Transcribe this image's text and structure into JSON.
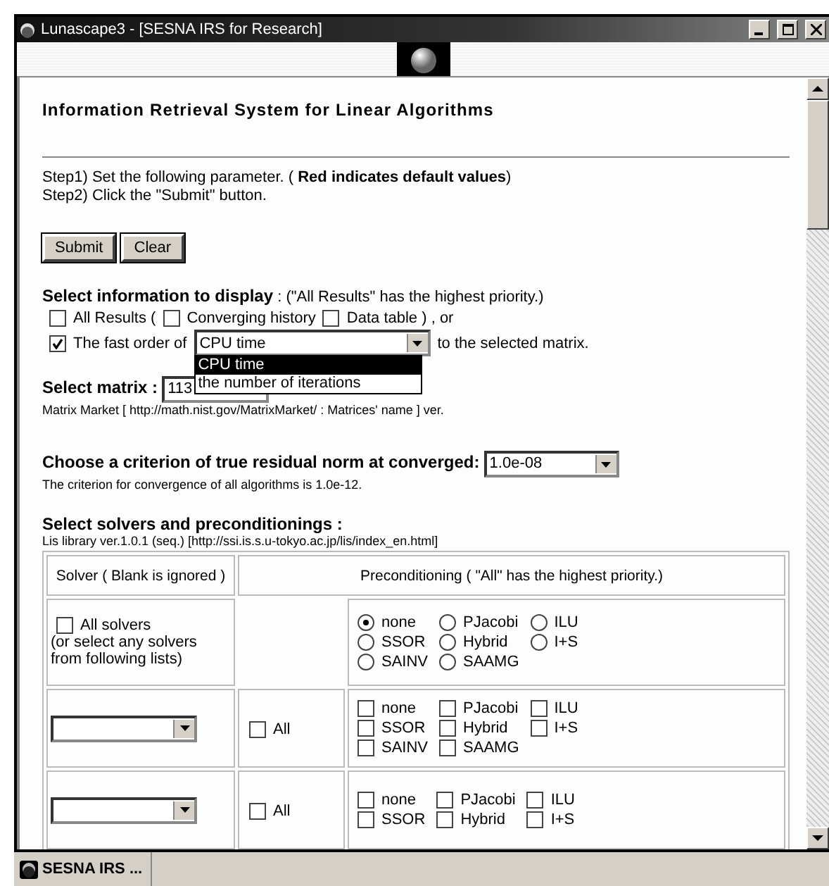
{
  "window": {
    "title": "Lunascape3 - [SESNA IRS for Research]"
  },
  "page": {
    "heading": "Information Retrieval System for Linear Algorithms",
    "steps": [
      "Step1) Set the following parameter. ( **Red indicates default values**)",
      "Step2) Click the \"Submit\" button."
    ],
    "buttons": [
      "Submit",
      "Clear"
    ],
    "display": {
      "label": "Select information to display",
      "note": ": (\"All Results\" has the highest priority.)",
      "options": [
        {
          "label": "All Results (",
          "checked": false
        },
        {
          "label": "Converging history",
          "checked": false
        },
        {
          "label": "Data table ) , or",
          "checked": false
        }
      ],
      "fast_order": {
        "checked": true,
        "prefix": "The fast order of",
        "value": "CPU time",
        "suffix": "to the selected matrix.",
        "dropdown": [
          {
            "label": "CPU time",
            "selected": true
          },
          {
            "label": "the number of iterations",
            "selected": false
          }
        ]
      }
    },
    "matrix": {
      "label": "Select matrix :",
      "value": "113",
      "source_prefix": "Matrix Market [",
      "link": "http://math.nist.gov/MatrixMarket/",
      "separator": ":",
      "link2": "Matrices' name",
      "source_suffix": "] ver."
    },
    "criterion": {
      "label": "Choose a criterion of true residual norm at converged:",
      "value": "1.0e-08",
      "note": "The criterion for convergence of all algorithms is 1.0e-12."
    },
    "solvers": {
      "label": "Select solvers and preconditionings :",
      "note": "Lis library ver.1.0.1 (seq.) [",
      "link": "http://ssi.is.s.u-tokyo.ac.jp/lis/index_en.html",
      "note_end": "]",
      "columns": [
        "Solver ( Blank is ignored )",
        "Preconditioning ( \"All\" has the highest priority.)"
      ],
      "rows": [
        {
          "kind": "all",
          "checkbox_label": "All solvers",
          "checked": false,
          "hint": "(or select any solvers from following lists)",
          "options": [
            {
              "label": "none",
              "selected": true
            },
            {
              "label": "PJacobi",
              "selected": false
            },
            {
              "label": "ILU",
              "selected": false
            },
            {
              "label": "SSOR",
              "selected": false
            },
            {
              "label": "Hybrid",
              "selected": false
            },
            {
              "label": "I+S",
              "selected": false
            },
            {
              "label": "SAINV",
              "selected": false
            },
            {
              "label": "SAAMG",
              "selected": false
            }
          ]
        },
        {
          "kind": "solver",
          "all_label": "All",
          "all_checked": false,
          "options": [
            {
              "label": "none",
              "checked": false
            },
            {
              "label": "PJacobi",
              "checked": false
            },
            {
              "label": "ILU",
              "checked": false
            },
            {
              "label": "SSOR",
              "checked": false
            },
            {
              "label": "Hybrid",
              "checked": false
            },
            {
              "label": "I+S",
              "checked": false
            },
            {
              "label": "SAINV",
              "checked": false
            },
            {
              "label": "SAAMG",
              "checked": false
            }
          ]
        },
        {
          "kind": "solver",
          "all_label": "All",
          "all_checked": false,
          "options": [
            {
              "label": "none",
              "checked": false
            },
            {
              "label": "PJacobi",
              "checked": false
            },
            {
              "label": "ILU",
              "checked": false
            },
            {
              "label": "SSOR",
              "checked": false
            },
            {
              "label": "Hybrid",
              "checked": false
            },
            {
              "label": "I+S",
              "checked": false
            }
          ]
        }
      ]
    }
  },
  "taskbar": {
    "item": "SESNA IRS ..."
  }
}
